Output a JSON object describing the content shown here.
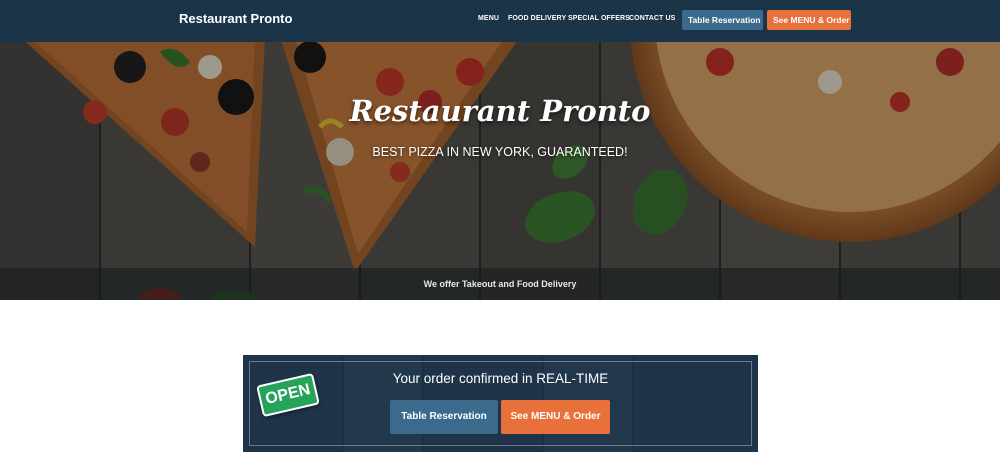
{
  "nav": {
    "brand": "Restaurant Pronto",
    "links": [
      "MENU",
      "FOOD DELIVERY",
      "SPECIAL OFFERS",
      "CONTACT US"
    ],
    "reservation_label": "Table Reservation",
    "order_label": "See MENU & Order"
  },
  "hero": {
    "title": "Restaurant Pronto",
    "subtitle": "BEST PIZZA IN NEW YORK, GUARANTEED!",
    "band_text": "We offer Takeout and Food Delivery"
  },
  "promo": {
    "title": "Your order confirmed in REAL-TIME",
    "badge": "OPEN",
    "reservation_label": "Table Reservation",
    "order_label": "See MENU & Order"
  },
  "colors": {
    "navbar": "#1c3448",
    "button_blue": "#3b6a8c",
    "button_orange": "#e8703a",
    "badge_green": "#26a35a"
  }
}
